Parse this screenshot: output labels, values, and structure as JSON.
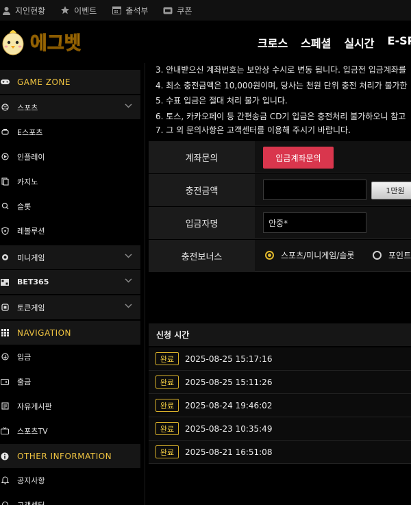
{
  "topbar": {
    "items": [
      {
        "label": "지인현황",
        "icon": "person-icon"
      },
      {
        "label": "이벤트",
        "icon": "star-icon"
      },
      {
        "label": "출석부",
        "icon": "calendar-icon"
      },
      {
        "label": "쿠폰",
        "icon": "coupon-icon"
      }
    ]
  },
  "header": {
    "logo_text": "에그벳",
    "nav": [
      "크로스",
      "스페셜",
      "실시간",
      "E-SPO"
    ]
  },
  "sidebar": {
    "game_zone": "GAME ZONE",
    "sports": "스포츠",
    "esports": "E스포츠",
    "inplay": "인플레이",
    "casino": "카지노",
    "slot": "슬롯",
    "evolution": "레볼루션",
    "minigame": "미니게임",
    "bet365": "BET365",
    "token": "토큰게임",
    "navigation": "NAVIGATION",
    "deposit": "입금",
    "withdraw": "출금",
    "board": "자유게시판",
    "sportstv": "스포츠TV",
    "other": "OTHER INFORMATION",
    "notice": "공지사항",
    "support": "고객센터"
  },
  "notices": [
    "3. 안내받으신 계좌번호는 보안상 수시로 변동 됩니다. 입금전 입금계좌를",
    "4. 최소 충전금액은 10,000원이며, 당사는 천원 단위 충전 처리가 불가한",
    "5. 수표 입금은 절대 처리 불가 입니다.",
    "6. 토스, 카카오페이 등 간편송금 CD기 입금은 충전처리 불가하오니 참고",
    "7. 그 외 문의사항은 고객센터를 이용해 주시기 바랍니다."
  ],
  "form": {
    "account_label": "계좌문의",
    "account_button": "입금계좌문의",
    "amount_label": "충전금액",
    "amount_value": "",
    "amount_button": "1만원",
    "name_label": "입금자명",
    "name_value": "안중*",
    "bonus_label": "충전보너스",
    "bonus_option1": "스포츠/미니게임/슬롯",
    "bonus_option2": "포인트"
  },
  "history": {
    "header": "신청 시간",
    "rows": [
      {
        "status": "완료",
        "time": "2025-08-25 15:17:16"
      },
      {
        "status": "완료",
        "time": "2025-08-25 15:11:26"
      },
      {
        "status": "완료",
        "time": "2025-08-24 19:46:02"
      },
      {
        "status": "완료",
        "time": "2025-08-23 10:35:49"
      },
      {
        "status": "완료",
        "time": "2025-08-21 16:51:08"
      }
    ]
  },
  "colors": {
    "accent": "#f0c441",
    "button_red": "#d9364d",
    "background": "#000000"
  }
}
